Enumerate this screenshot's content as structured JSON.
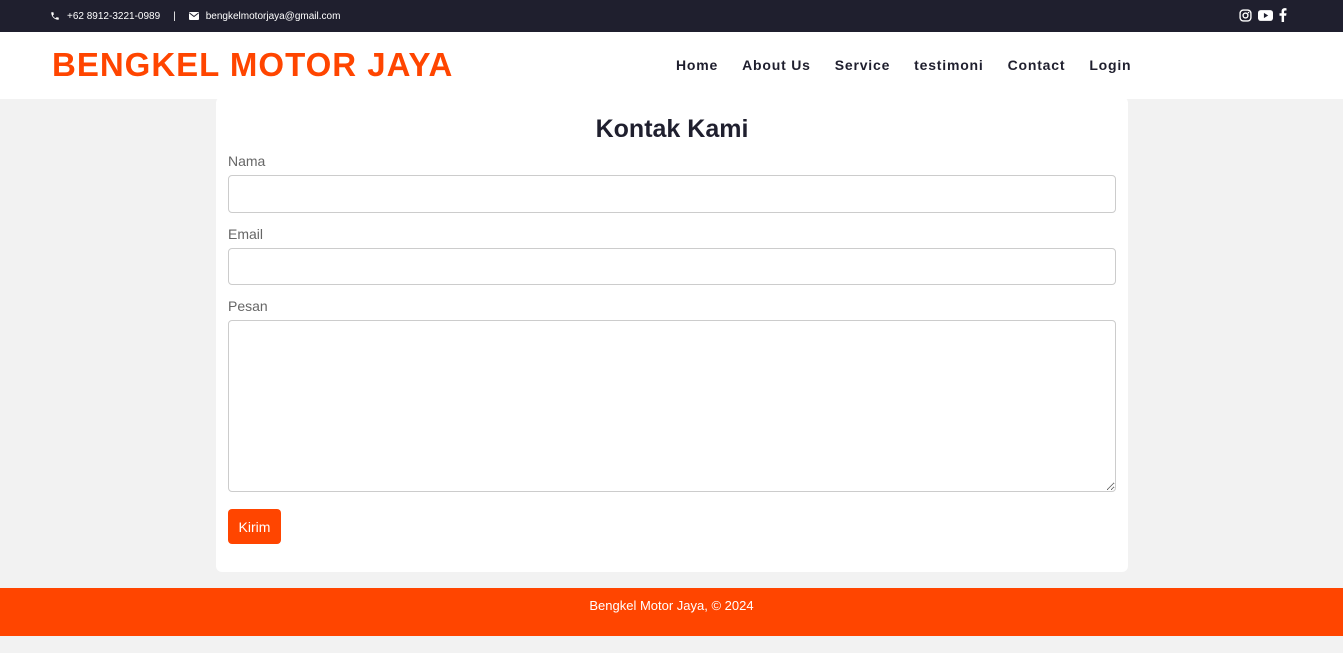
{
  "topbar": {
    "phone": "+62 8912-3221-0989",
    "separator": "|",
    "email": "bengkelmotorjaya@gmail.com",
    "icons": [
      "phone-icon",
      "envelope-icon",
      "instagram-icon",
      "youtube-icon",
      "facebook-icon"
    ]
  },
  "header": {
    "brand": "BENGKEL MOTOR JAYA",
    "nav": [
      "Home",
      "About Us",
      "Service",
      "testimoni",
      "Contact",
      "Login"
    ]
  },
  "form": {
    "title": "Kontak Kami",
    "name_label": "Nama",
    "name_value": "",
    "email_label": "Email",
    "email_value": "",
    "message_label": "Pesan",
    "message_value": "",
    "submit_label": "Kirim"
  },
  "footer": {
    "text": "Bengkel Motor Jaya, © 2024"
  },
  "colors": {
    "accent": "#ff4500",
    "topbar_bg": "#1f1f2e",
    "page_bg": "#f2f2f2"
  }
}
